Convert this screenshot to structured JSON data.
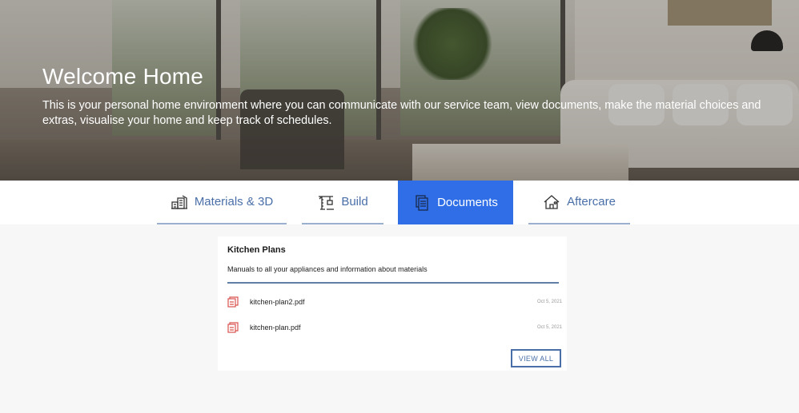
{
  "hero": {
    "title": "Welcome Home",
    "text": "This is your personal home environment where you can communicate with our service team, view documents, make the material choices and extras, visualise your home and keep track of schedules."
  },
  "tabs": [
    {
      "label": "Materials & 3D",
      "icon": "materials-icon",
      "active": false
    },
    {
      "label": "Build",
      "icon": "crane-icon",
      "active": false
    },
    {
      "label": "Documents",
      "icon": "documents-icon",
      "active": true
    },
    {
      "label": "Aftercare",
      "icon": "house-icon",
      "active": false
    }
  ],
  "card": {
    "title": "Kitchen Plans",
    "description": "Manuals to all your appliances and information about materials",
    "files": [
      {
        "name": "kitchen-plan2.pdf",
        "date": "Oct 5, 2021",
        "icon": "pdf-file-icon"
      },
      {
        "name": "kitchen-plan.pdf",
        "date": "Oct 5, 2021",
        "icon": "pdf-file-icon"
      }
    ],
    "view_all_label": "VIEW ALL"
  },
  "colors": {
    "accent": "#2f6ee6",
    "tab_text": "#4a6fa8",
    "file_icon": "#d9534f",
    "page_bg": "#f7f7f7"
  }
}
